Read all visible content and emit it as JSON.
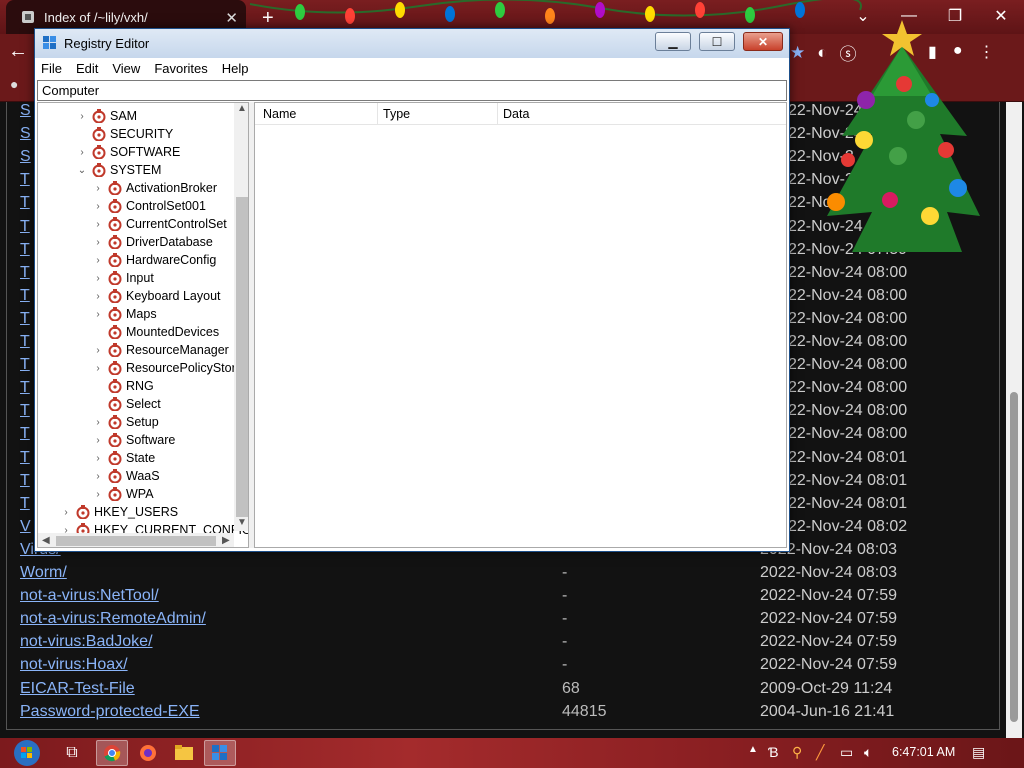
{
  "browser": {
    "tab_title": "Index of /~lily/vxh/",
    "tab_close": "✕",
    "new_tab": "+"
  },
  "listing": {
    "rows": [
      {
        "name": "S",
        "size": "",
        "date": "22-Nov-24 07:"
      },
      {
        "name": "S",
        "size": "",
        "date": "22-Nov-24 07:"
      },
      {
        "name": "S",
        "size": "",
        "date": "22-Nov-2"
      },
      {
        "name": "T",
        "size": "",
        "date": "22-Nov-24"
      },
      {
        "name": "T",
        "size": "",
        "date": "22-Nov-24"
      },
      {
        "name": "T",
        "size": "",
        "date": "22-Nov-24"
      },
      {
        "name": "T",
        "size": "",
        "date": "22-Nov-24 07:59"
      },
      {
        "name": "T",
        "size": "",
        "date": "22-Nov-24 08:00"
      },
      {
        "name": "T",
        "size": "",
        "date": "22-Nov-24 08:00"
      },
      {
        "name": "T",
        "size": "",
        "date": "22-Nov-24 08:00"
      },
      {
        "name": "T",
        "size": "",
        "date": "22-Nov-24 08:00"
      },
      {
        "name": "T",
        "size": "",
        "date": "22-Nov-24 08:00"
      },
      {
        "name": "T",
        "size": "",
        "date": "22-Nov-24 08:00"
      },
      {
        "name": "T",
        "size": "",
        "date": "22-Nov-24 08:00"
      },
      {
        "name": "T",
        "size": "",
        "date": "22-Nov-24 08:00"
      },
      {
        "name": "T",
        "size": "",
        "date": "22-Nov-24 08:01"
      },
      {
        "name": "T",
        "size": "",
        "date": "22-Nov-24 08:01"
      },
      {
        "name": "T",
        "size": "",
        "date": "22-Nov-24 08:01"
      },
      {
        "name": "V",
        "size": "",
        "date": "22-Nov-24 08:02"
      },
      {
        "name": "Virus/",
        "size": "-",
        "date": "2022-Nov-24 08:03"
      },
      {
        "name": "Worm/",
        "size": "-",
        "date": "2022-Nov-24 08:03"
      },
      {
        "name": "not-a-virus:NetTool/",
        "size": "-",
        "date": "2022-Nov-24 07:59"
      },
      {
        "name": "not-a-virus:RemoteAdmin/",
        "size": "-",
        "date": "2022-Nov-24 07:59"
      },
      {
        "name": "not-virus:BadJoke/",
        "size": "-",
        "date": "2022-Nov-24 07:59"
      },
      {
        "name": "not-virus:Hoax/",
        "size": "-",
        "date": "2022-Nov-24 07:59"
      },
      {
        "name": "EICAR-Test-File",
        "size": "68",
        "date": "2009-Oct-29 11:24"
      },
      {
        "name": "Password-protected-EXE",
        "size": "44815",
        "date": "2004-Jun-16 21:41"
      }
    ]
  },
  "regedit": {
    "title": "Registry Editor",
    "menu": [
      "File",
      "Edit",
      "View",
      "Favorites",
      "Help"
    ],
    "address": "Computer",
    "columns": [
      "Name",
      "Type",
      "Data"
    ],
    "tree": [
      {
        "label": "SAM",
        "depth": 2,
        "expander": "›"
      },
      {
        "label": "SECURITY",
        "depth": 2,
        "expander": ""
      },
      {
        "label": "SOFTWARE",
        "depth": 2,
        "expander": "›"
      },
      {
        "label": "SYSTEM",
        "depth": 2,
        "expander": "⌄"
      },
      {
        "label": "ActivationBroker",
        "depth": 3,
        "expander": "›"
      },
      {
        "label": "ControlSet001",
        "depth": 3,
        "expander": "›"
      },
      {
        "label": "CurrentControlSet",
        "depth": 3,
        "expander": "›"
      },
      {
        "label": "DriverDatabase",
        "depth": 3,
        "expander": "›"
      },
      {
        "label": "HardwareConfig",
        "depth": 3,
        "expander": "›"
      },
      {
        "label": "Input",
        "depth": 3,
        "expander": "›"
      },
      {
        "label": "Keyboard Layout",
        "depth": 3,
        "expander": "›"
      },
      {
        "label": "Maps",
        "depth": 3,
        "expander": "›"
      },
      {
        "label": "MountedDevices",
        "depth": 3,
        "expander": ""
      },
      {
        "label": "ResourceManager",
        "depth": 3,
        "expander": "›"
      },
      {
        "label": "ResourcePolicyStore",
        "depth": 3,
        "expander": "›"
      },
      {
        "label": "RNG",
        "depth": 3,
        "expander": ""
      },
      {
        "label": "Select",
        "depth": 3,
        "expander": ""
      },
      {
        "label": "Setup",
        "depth": 3,
        "expander": "›"
      },
      {
        "label": "Software",
        "depth": 3,
        "expander": "›"
      },
      {
        "label": "State",
        "depth": 3,
        "expander": "›"
      },
      {
        "label": "WaaS",
        "depth": 3,
        "expander": "›"
      },
      {
        "label": "WPA",
        "depth": 3,
        "expander": "›"
      },
      {
        "label": "HKEY_USERS",
        "depth": 1,
        "expander": "›"
      },
      {
        "label": "HKEY_CURRENT_CONFIG",
        "depth": 1,
        "expander": "›"
      }
    ]
  },
  "taskbar": {
    "clock": "6:47:01 AM"
  },
  "colors": {
    "link": "#8ab4f8",
    "page_bg": "#121212",
    "chrome_frame": "#6b191a"
  }
}
